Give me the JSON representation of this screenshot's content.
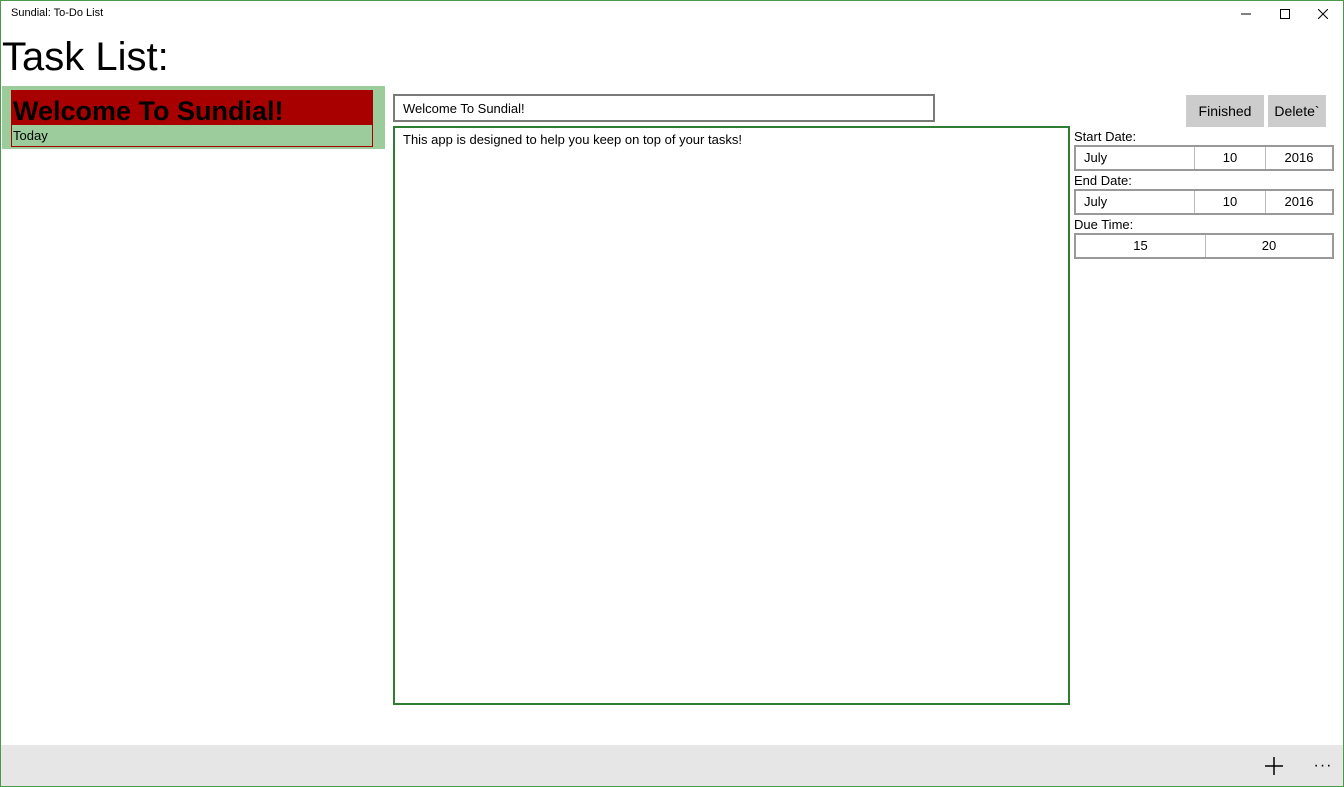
{
  "window": {
    "title": "Sundial: To-Do List"
  },
  "page": {
    "title": "Task List:"
  },
  "tasks": [
    {
      "name": "Welcome To Sundial!",
      "due": "Today",
      "color": "#a80000"
    }
  ],
  "editor": {
    "title_value": "Welcome To Sundial!",
    "body_value": "This app is designed to help you keep on top of your tasks!"
  },
  "actions": {
    "finished_label": "Finished",
    "delete_label": "Delete`"
  },
  "start_date": {
    "label": "Start Date:",
    "month": "July",
    "day": "10",
    "year": "2016"
  },
  "end_date": {
    "label": "End Date:",
    "month": "July",
    "day": "10",
    "year": "2016"
  },
  "due_time": {
    "label": "Due Time:",
    "hour": "15",
    "minute": "20"
  },
  "command_bar": {
    "more_label": "···"
  },
  "colors": {
    "task_list_background": "#9ccb9c",
    "task_accent": "#a80000",
    "body_border": "#2e7d32",
    "command_bar": "#e6e6e6"
  }
}
